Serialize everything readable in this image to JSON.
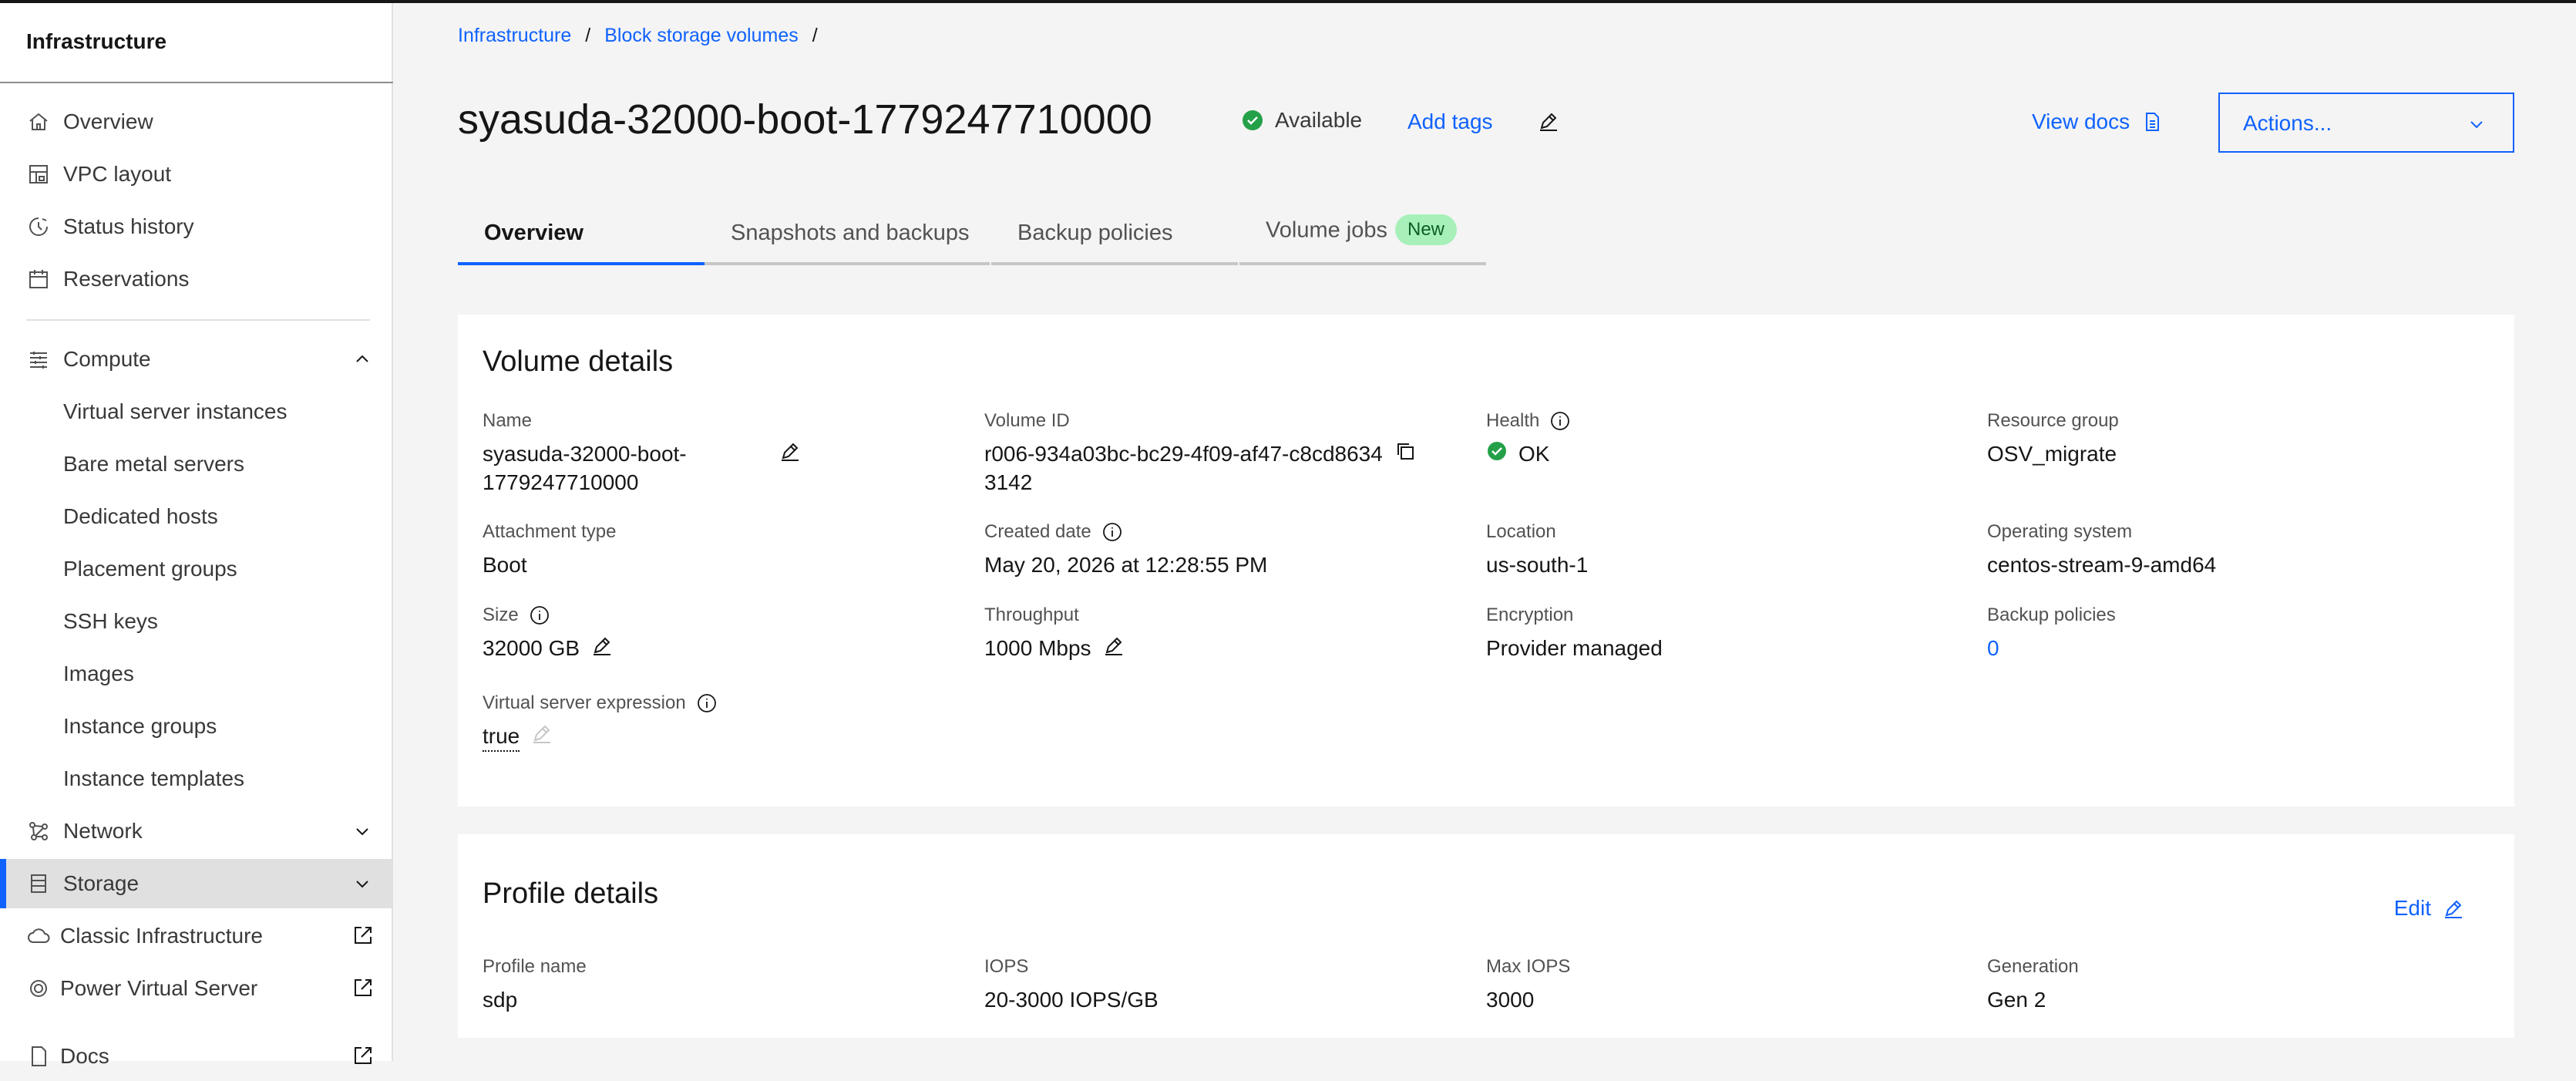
{
  "sidebar": {
    "title": "Infrastructure",
    "items": [
      {
        "label": "Overview"
      },
      {
        "label": "VPC layout"
      },
      {
        "label": "Status history"
      },
      {
        "label": "Reservations"
      },
      {
        "label": "Compute"
      },
      {
        "label": "Virtual server instances"
      },
      {
        "label": "Bare metal servers"
      },
      {
        "label": "Dedicated hosts"
      },
      {
        "label": "Placement groups"
      },
      {
        "label": "SSH keys"
      },
      {
        "label": "Images"
      },
      {
        "label": "Instance groups"
      },
      {
        "label": "Instance templates"
      },
      {
        "label": "Network"
      },
      {
        "label": "Storage"
      },
      {
        "label": "Classic Infrastructure"
      },
      {
        "label": "Power Virtual Server"
      },
      {
        "label": "Docs"
      }
    ]
  },
  "breadcrumb": {
    "items": [
      "Infrastructure",
      "Block storage volumes"
    ],
    "separator": "/"
  },
  "header": {
    "title": "syasuda-32000-boot-1779247710000",
    "status": "Available",
    "add_tags": "Add tags",
    "view_docs": "View docs",
    "actions_label": "Actions..."
  },
  "tabs": [
    {
      "label": "Overview",
      "selected": true
    },
    {
      "label": "Snapshots and backups"
    },
    {
      "label": "Backup policies"
    },
    {
      "label": "Volume jobs",
      "badge": "New"
    }
  ],
  "volume_details": {
    "title": "Volume details",
    "name": {
      "label": "Name",
      "line1": "syasuda-32000-boot-",
      "line2": "1779247710000"
    },
    "volume_id": {
      "label": "Volume ID",
      "line1": "r006-934a03bc-bc29-4f09-af47-c8cd8634",
      "line2": "3142"
    },
    "health": {
      "label": "Health",
      "value": "OK"
    },
    "resource_group": {
      "label": "Resource group",
      "value": "OSV_migrate"
    },
    "attachment_type": {
      "label": "Attachment type",
      "value": "Boot"
    },
    "created_date": {
      "label": "Created date",
      "value": "May 20, 2026 at 12:28:55 PM"
    },
    "location": {
      "label": "Location",
      "value": "us-south-1"
    },
    "operating_system": {
      "label": "Operating system",
      "value": "centos-stream-9-amd64"
    },
    "size": {
      "label": "Size",
      "value": "32000 GB"
    },
    "throughput": {
      "label": "Throughput",
      "value": "1000 Mbps"
    },
    "encryption": {
      "label": "Encryption",
      "value": "Provider managed"
    },
    "backup_policies": {
      "label": "Backup policies",
      "value": "0"
    },
    "vs_expression": {
      "label": "Virtual server expression",
      "value": "true"
    }
  },
  "profile_details": {
    "title": "Profile details",
    "edit_label": "Edit",
    "profile_name": {
      "label": "Profile name",
      "value": "sdp"
    },
    "iops": {
      "label": "IOPS",
      "value": "20-3000 IOPS/GB"
    },
    "max_iops": {
      "label": "Max IOPS",
      "value": "3000"
    },
    "generation": {
      "label": "Generation",
      "value": "Gen 2"
    }
  },
  "colors": {
    "accent": "#0f62fe",
    "success": "#24a148",
    "badge_bg": "#a7f0ba",
    "background": "#f4f4f4"
  },
  "icons": {
    "home": "home-icon",
    "vpc": "vpc-layout-icon",
    "status": "status-history-icon",
    "calendar": "calendar-icon",
    "compute": "compute-icon",
    "network": "network-icon",
    "storage": "storage-icon",
    "classic": "cloud-icon",
    "power": "power-virtual-server-icon",
    "docs": "docs-icon"
  }
}
